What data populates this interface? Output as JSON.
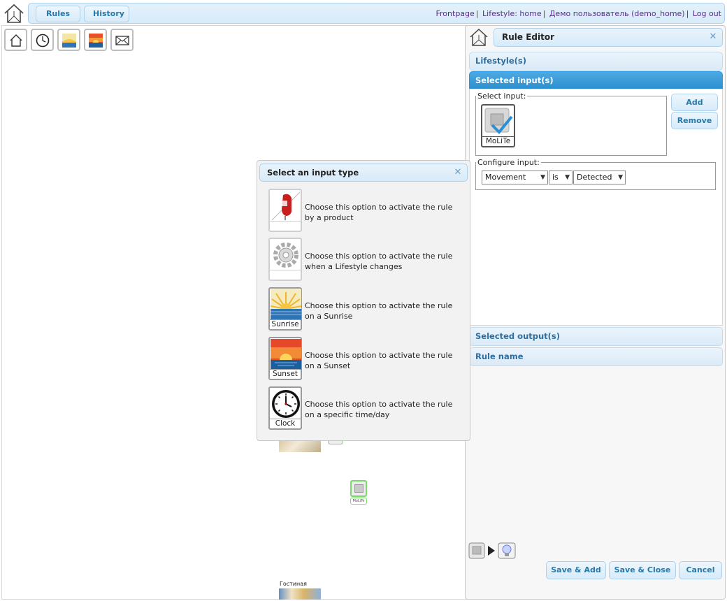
{
  "topbar": {
    "rules_label": "Rules",
    "history_label": "History",
    "links": {
      "frontpage": "Frontpage",
      "lifestyle": "Lifestyle: home",
      "user": "Демо пользователь (demo_home)",
      "logout": "Log out"
    }
  },
  "canvas": {
    "room1_label": "Гостиная",
    "node_label": "MoLiTe"
  },
  "rule_editor": {
    "title": "Rule Editor",
    "sections": {
      "lifestyles": "Lifestyle(s)",
      "selected_inputs": "Selected input(s)",
      "selected_outputs": "Selected output(s)",
      "rule_name": "Rule name"
    },
    "select_input_legend": "Select input:",
    "add_label": "Add",
    "remove_label": "Remove",
    "selected_input_name": "MoLiTe",
    "configure_input_legend": "Configure input:",
    "config": {
      "property": "Movement",
      "operator": "is",
      "value": "Detected"
    },
    "save_add_label": "Save & Add",
    "save_close_label": "Save & Close",
    "cancel_label": "Cancel"
  },
  "input_dialog": {
    "title": "Select an input type",
    "options": [
      {
        "caption": "Product",
        "text": "Choose this option to activate the rule by a product"
      },
      {
        "caption": "Lifestyle",
        "text": "Choose this option to activate the rule when a Lifestyle changes"
      },
      {
        "caption": "Sunrise",
        "text": "Choose this option to activate the rule on a Sunrise"
      },
      {
        "caption": "Sunset",
        "text": "Choose this option to activate the rule on a Sunset"
      },
      {
        "caption": "Clock",
        "text": "Choose this option to activate the rule on a specific time/day"
      }
    ]
  },
  "colors": {
    "accent": "#2779aa",
    "active_header": "#2b8fd0",
    "link": "#5a2d8c",
    "node_border": "#7ed66f"
  }
}
